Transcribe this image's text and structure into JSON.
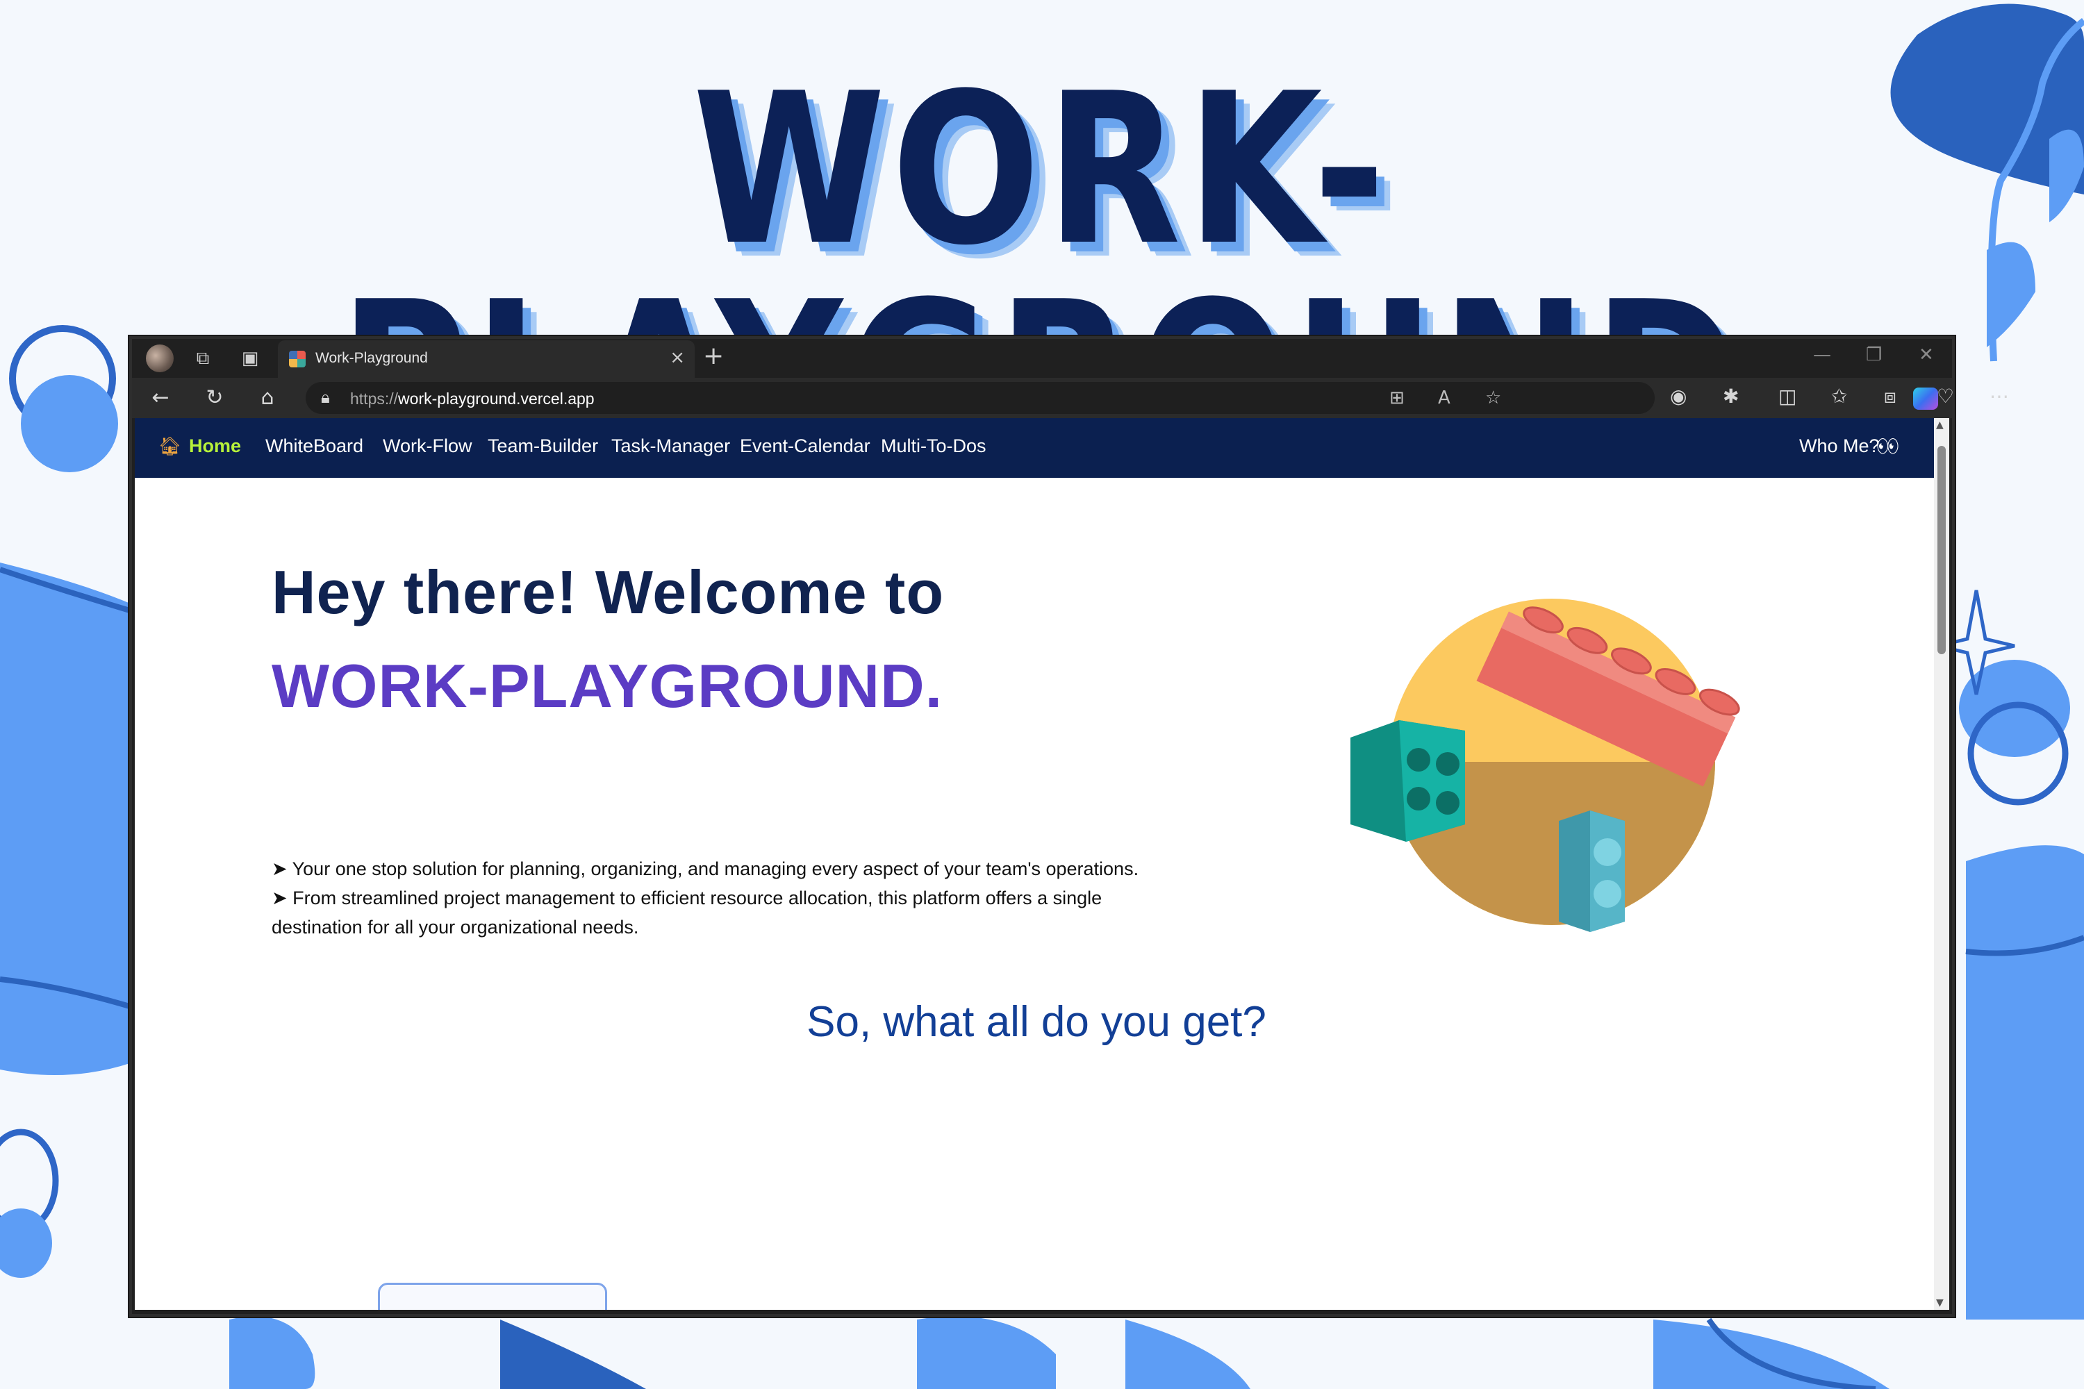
{
  "poster": {
    "title": "WORK-PLAYGROUND"
  },
  "browser": {
    "tab_title": "Work-Playground",
    "tab_close": "×",
    "new_tab": "+",
    "url_prefix": "https://",
    "url_host": "work-playground.vercel.app",
    "window_controls": {
      "minimize": "—",
      "restore": "❐",
      "close": "✕"
    }
  },
  "site": {
    "nav": [
      {
        "label": "Home"
      },
      {
        "label": "WhiteBoard"
      },
      {
        "label": "Work-Flow"
      },
      {
        "label": "Team-Builder"
      },
      {
        "label": "Task-Manager"
      },
      {
        "label": "Event-Calendar"
      },
      {
        "label": "Multi-To-Dos"
      }
    ],
    "who_me": "Who Me?",
    "hero": {
      "line1": "Hey there! Welcome to",
      "line2": "WORK-PLAYGROUND.",
      "bullets": [
        "➤ Your one stop solution for planning, organizing, and managing every aspect of your team's operations.",
        "➤ From streamlined project management to efficient resource allocation, this platform offers a single destination for all your organizational needs."
      ]
    },
    "section_heading": "So, what all do you get?"
  },
  "colors": {
    "poster_title": "#0c2157",
    "nav_bg": "#0b2050",
    "nav_active": "#b7f23a",
    "hero_accent": "#5b3cc4",
    "section_heading": "#123f96"
  },
  "icons": {
    "home": "house-icon",
    "who_me": "eyes-icon",
    "back": "arrow-left-icon",
    "refresh": "refresh-icon",
    "browser_home": "home-icon",
    "lock": "lock-icon"
  }
}
